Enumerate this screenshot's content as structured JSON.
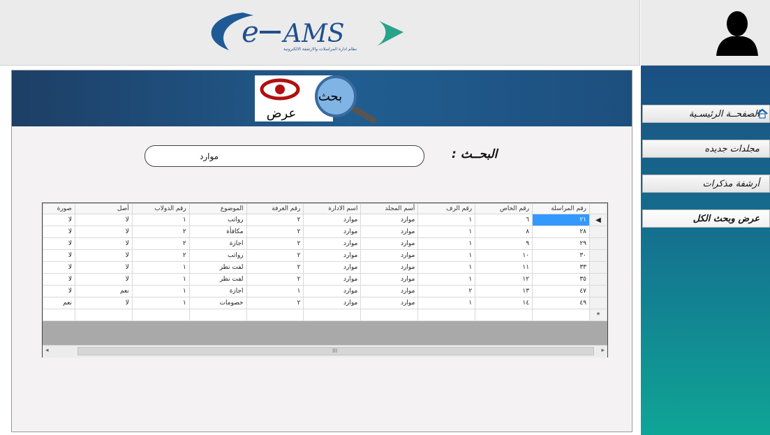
{
  "logo": {
    "text": "e-AMS",
    "tagline": "نظام ادارة المراسلات والارشفة الالكترونية"
  },
  "banner": {
    "icon_text_top": "بحث",
    "icon_text_bottom": "عرض"
  },
  "sidebar": {
    "items": [
      {
        "label": "الصفحــة الرئيسـية",
        "icon": "home-icon"
      },
      {
        "label": "مجلدات جديده"
      },
      {
        "label": "أرشفة مذكرات"
      },
      {
        "label": "عرض وبحث الكل"
      }
    ]
  },
  "search": {
    "label": "البحــث :",
    "value": "موارد"
  },
  "grid": {
    "columns": [
      "رقم المراسلة",
      "رقم الخاص",
      "رقم الرف",
      "أسم المجلد",
      "اسم الادارة",
      "رقم الغرفة",
      "الموضوع",
      "رقم الدولاب",
      "أصل",
      "صورة"
    ],
    "rows": [
      [
        "٢١",
        "٦",
        "١",
        "موارد",
        "موارد",
        "٢",
        "رواتب",
        "١",
        "لا",
        "لا"
      ],
      [
        "٢٨",
        "٨",
        "١",
        "موارد",
        "موارد",
        "٢",
        "مكافأة",
        "٢",
        "لا",
        "لا"
      ],
      [
        "٢٩",
        "٩",
        "١",
        "موارد",
        "موارد",
        "٢",
        "اجازة",
        "٢",
        "لا",
        "لا"
      ],
      [
        "٣٠",
        "١٠",
        "١",
        "موارد",
        "موارد",
        "٢",
        "رواتب",
        "٢",
        "لا",
        "لا"
      ],
      [
        "٣٣",
        "١١",
        "١",
        "موارد",
        "موارد",
        "٢",
        "لفت نظر",
        "١",
        "لا",
        "لا"
      ],
      [
        "٣٥",
        "١٢",
        "١",
        "موارد",
        "موارد",
        "٢",
        "لفت نظر",
        "١",
        "لا",
        "لا"
      ],
      [
        "٤٧",
        "١٣",
        "٢",
        "موارد",
        "موارد",
        "١",
        "اجازة",
        "١",
        "نعم",
        "لا"
      ],
      [
        "٤٩",
        "١٤",
        "١",
        "موارد",
        "موارد",
        "٢",
        "خصومات",
        "١",
        "لا",
        "نعم"
      ]
    ],
    "new_row_marker": "*",
    "current_row_marker": "◀",
    "scroll_grip": "III"
  },
  "colors": {
    "sidebar_top": "#1a4f82",
    "sidebar_bottom": "#0fa596",
    "banner": "#215d90",
    "selected_cell": "#3399ff"
  }
}
